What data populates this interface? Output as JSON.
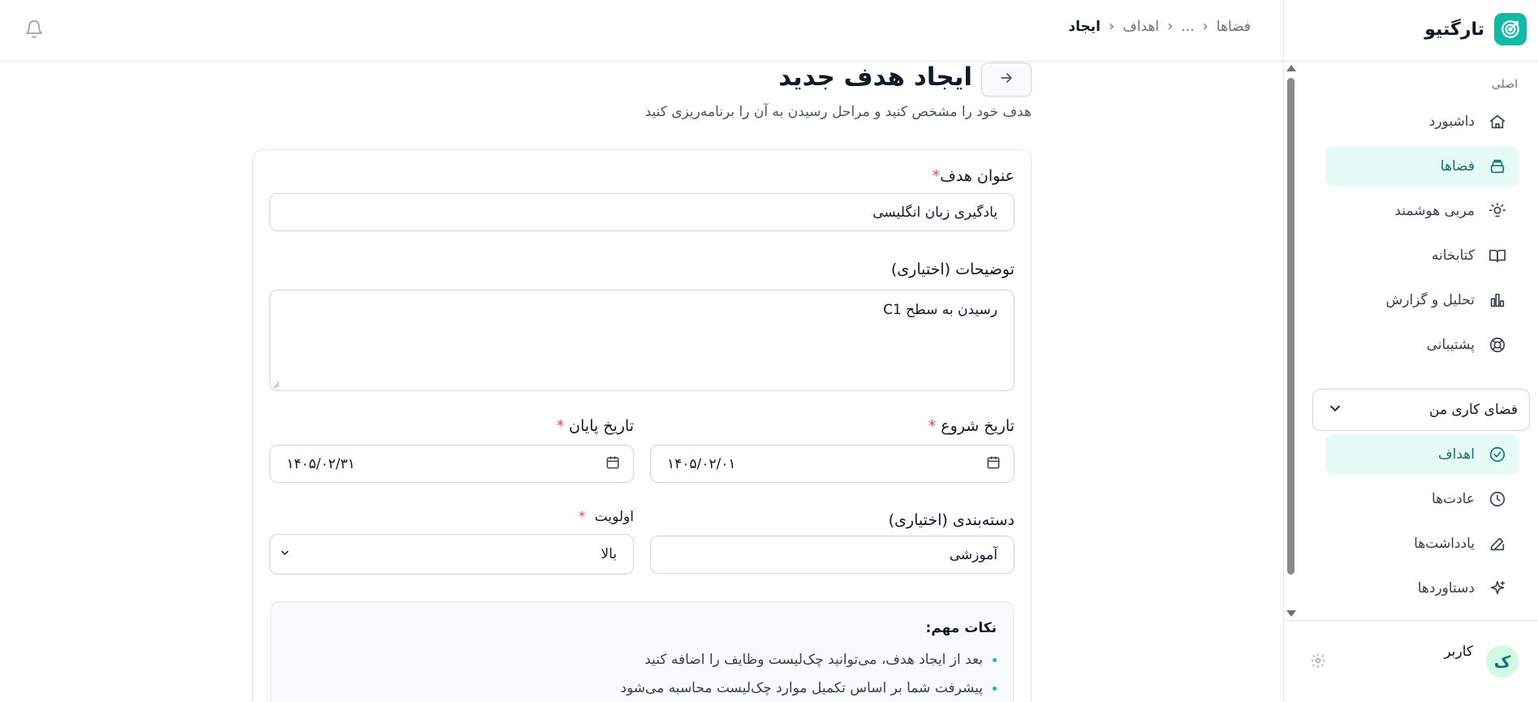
{
  "brand": {
    "name": "تارگتیو"
  },
  "sidebar": {
    "section_label": "اصلی",
    "main_items": [
      {
        "label": "داشبورد",
        "icon": "home-icon",
        "active": false
      },
      {
        "label": "فضاها",
        "icon": "layers-icon",
        "active": true
      },
      {
        "label": "مربی هوشمند",
        "icon": "lightbulb-icon",
        "active": false
      },
      {
        "label": "کتابخانه",
        "icon": "book-icon",
        "active": false
      },
      {
        "label": "تحلیل و گزارش",
        "icon": "chart-icon",
        "active": false
      },
      {
        "label": "پشتیبانی",
        "icon": "lifebuoy-icon",
        "active": false
      }
    ],
    "workspace_select": {
      "value": "فضای کاری من"
    },
    "workspace_items": [
      {
        "label": "اهداف",
        "icon": "target-check-icon",
        "active": true
      },
      {
        "label": "عادت‌ها",
        "icon": "clock-icon",
        "active": false
      },
      {
        "label": "یادداشت‌ها",
        "icon": "edit-icon",
        "active": false
      },
      {
        "label": "دستاوردها",
        "icon": "sparkles-icon",
        "active": false
      }
    ],
    "user": {
      "avatar_letter": "ک",
      "name": "کاربر"
    }
  },
  "breadcrumb": [
    "فضاها",
    "...",
    "اهداف",
    "ایجاد"
  ],
  "page": {
    "title": "ایجاد هدف جدید",
    "subtitle": "هدف خود را مشخص کنید و مراحل رسیدن به آن را برنامه‌ریزی کنید"
  },
  "form": {
    "title_label": "عنوان هدف",
    "title_value": "یادگیری زبان انگلیسی",
    "description_label": "توضیحات (اختیاری)",
    "description_value": "رسیدن به سطح C1",
    "start_date_label": "تاریخ شروع",
    "start_date_value": "۱۴۰۵/۰۲/۰۱",
    "end_date_label": "تاریخ پایان",
    "end_date_value": "۱۴۰۵/۰۲/۳۱",
    "category_label": "دسته‌بندی (اختیاری)",
    "category_value": "آموزشی",
    "priority_label": "اولویت",
    "priority_value": "بالا",
    "required_mark": "*"
  },
  "notes": {
    "title": "نکات مهم:",
    "items": [
      "بعد از ایجاد هدف، می‌توانید چک‌لیست وظایف را اضافه کنید",
      "پیشرفت شما بر اساس تکمیل موارد چک‌لیست محاسبه می‌شود"
    ]
  },
  "colors": {
    "accent": "#14b8a6",
    "active_bg": "#e6faf6",
    "required": "#ef4444"
  }
}
